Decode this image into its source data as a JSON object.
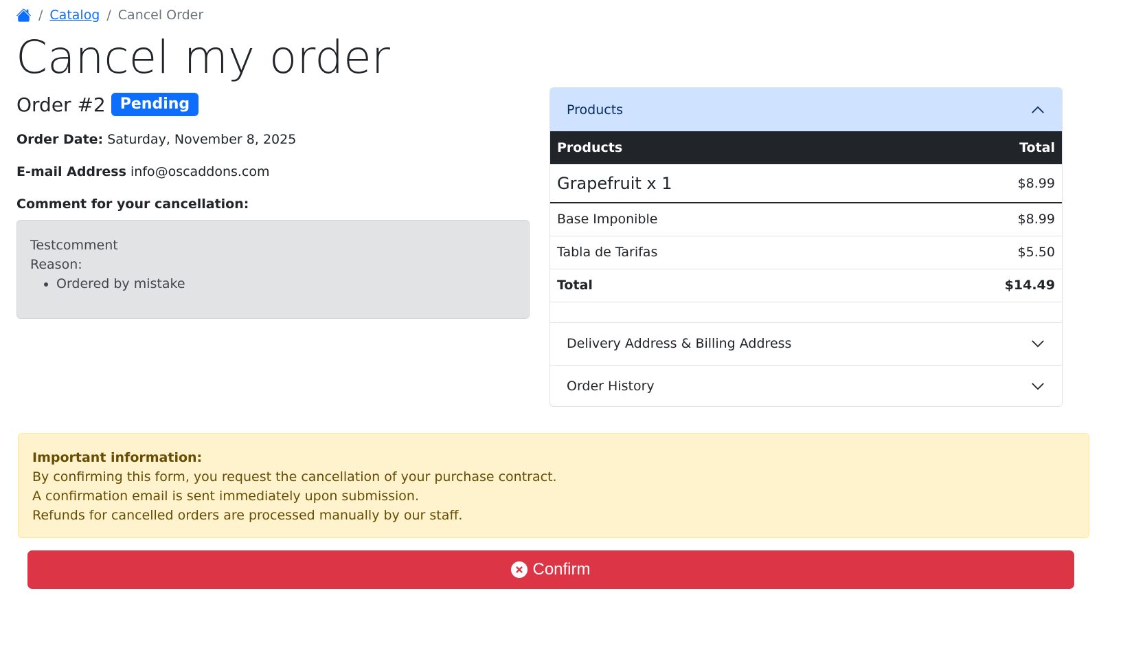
{
  "breadcrumb": {
    "home_icon": "home-icon",
    "separator": "/",
    "catalog": "Catalog",
    "current": "Cancel Order"
  },
  "page": {
    "title": "Cancel my order"
  },
  "order": {
    "number": "Order #2",
    "status": "Pending",
    "date_label": "Order Date:",
    "date_value": "Saturday, November 8, 2025",
    "email_label": "E-mail Address",
    "email_value": "info@oscaddons.com",
    "comment_label": "Comment for your cancellation:",
    "comment_text": "Testcomment",
    "reason_label": "Reason:",
    "reasons": [
      "Ordered by mistake"
    ]
  },
  "accordion": {
    "products_header": "Products",
    "table": {
      "col_product": "Products",
      "col_total": "Total",
      "item_name": "Grapefruit x 1",
      "item_price": "$8.99",
      "rows": [
        {
          "label": "Base Imponible",
          "value": "$8.99"
        },
        {
          "label": "Tabla de Tarifas",
          "value": "$5.50"
        }
      ],
      "total_label": "Total",
      "total_value": "$14.49"
    },
    "address_header": "Delivery Address & Billing Address",
    "history_header": "Order History"
  },
  "alert": {
    "title": "Important information:",
    "lines": [
      "By confirming this form, you request the cancellation of your purchase contract.",
      "A confirmation email is sent immediately upon submission.",
      "Refunds for cancelled orders are processed manually by our staff."
    ]
  },
  "confirm": {
    "label": "Confirm",
    "icon": "x-circle-icon"
  },
  "colors": {
    "primary": "#0d6efd",
    "danger": "#dc3545",
    "warning_bg": "#fff3cd",
    "accordion_active": "#cfe2ff"
  }
}
